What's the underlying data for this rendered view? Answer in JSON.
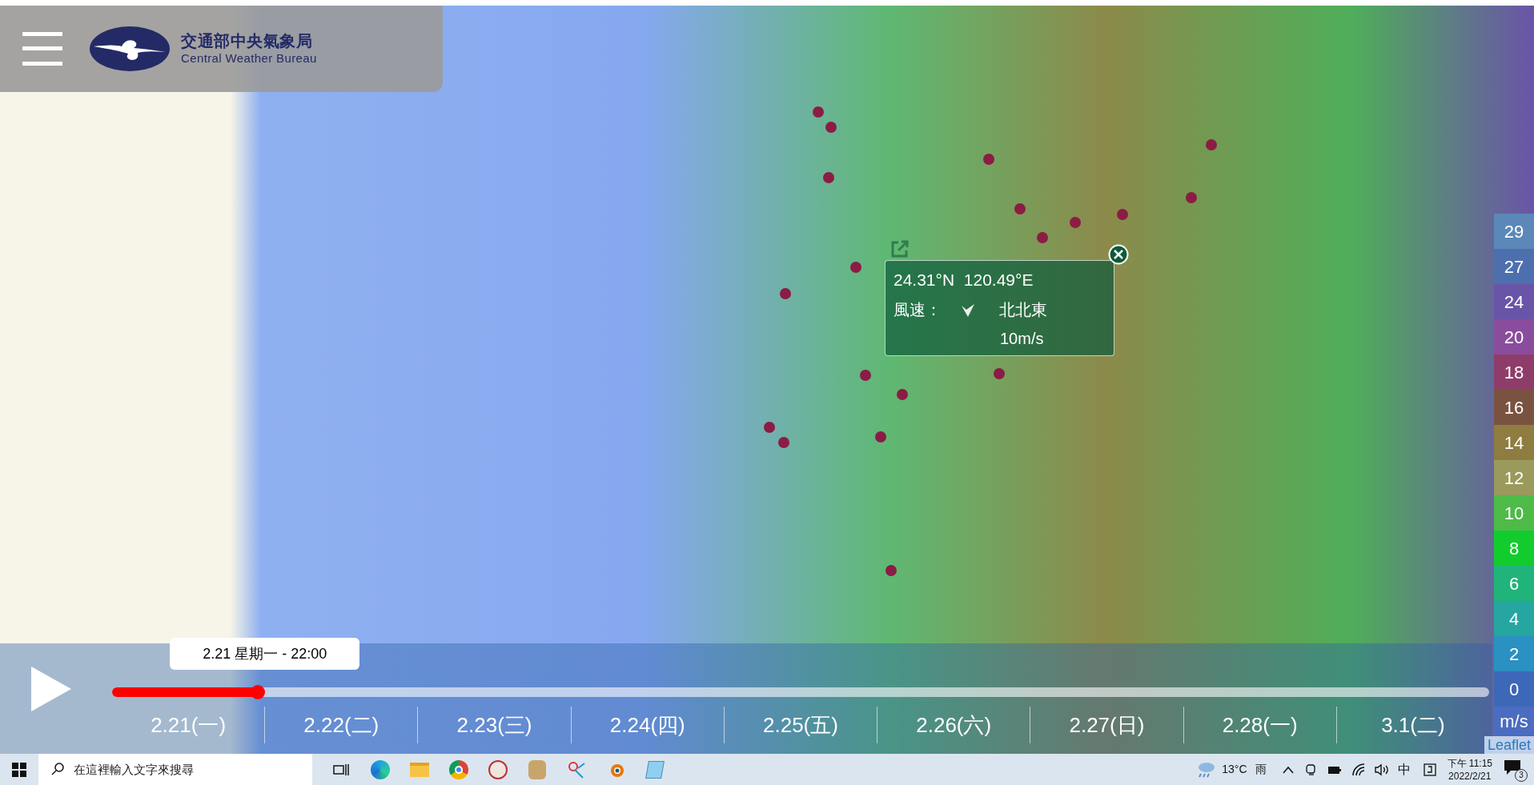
{
  "header": {
    "title": "交通部中央氣象局",
    "subtitle": "Central Weather Bureau"
  },
  "popup": {
    "coordinates": "24.31°N  120.49°E",
    "label": "風速：",
    "direction": "北北東",
    "speed": "10m/s"
  },
  "legend": {
    "unit": "m/s",
    "items": [
      {
        "label": "29",
        "color": "#5b88b8"
      },
      {
        "label": "27",
        "color": "#4d6fae"
      },
      {
        "label": "24",
        "color": "#6a54a8"
      },
      {
        "label": "20",
        "color": "#8a4c9c"
      },
      {
        "label": "18",
        "color": "#8e3d6a"
      },
      {
        "label": "16",
        "color": "#7a5240"
      },
      {
        "label": "14",
        "color": "#8f7c40"
      },
      {
        "label": "12",
        "color": "#9a9a5c"
      },
      {
        "label": "10",
        "color": "#4ebb48"
      },
      {
        "label": "8",
        "color": "#12cc2e"
      },
      {
        "label": "6",
        "color": "#21b47a"
      },
      {
        "label": "4",
        "color": "#26a6a0"
      },
      {
        "label": "2",
        "color": "#2b90c2"
      },
      {
        "label": "0",
        "color": "#3d68b8"
      }
    ]
  },
  "timeline": {
    "playing": false,
    "current": "2.21 星期一 - 22:00",
    "level": 0.106,
    "dates": [
      "2.21(一)",
      "2.22(二)",
      "2.23(三)",
      "2.24(四)",
      "2.25(五)",
      "2.26(六)",
      "2.27(日)",
      "2.28(一)",
      "3.1(二)"
    ]
  },
  "attribution": "Leaflet",
  "taskbar": {
    "search_placeholder": "在這裡輸入文字來搜尋",
    "temperature": "13°C",
    "condition": "雨",
    "ime": "中",
    "time": "下午 11:15",
    "date": "2022/2/21",
    "notifications": "3"
  }
}
